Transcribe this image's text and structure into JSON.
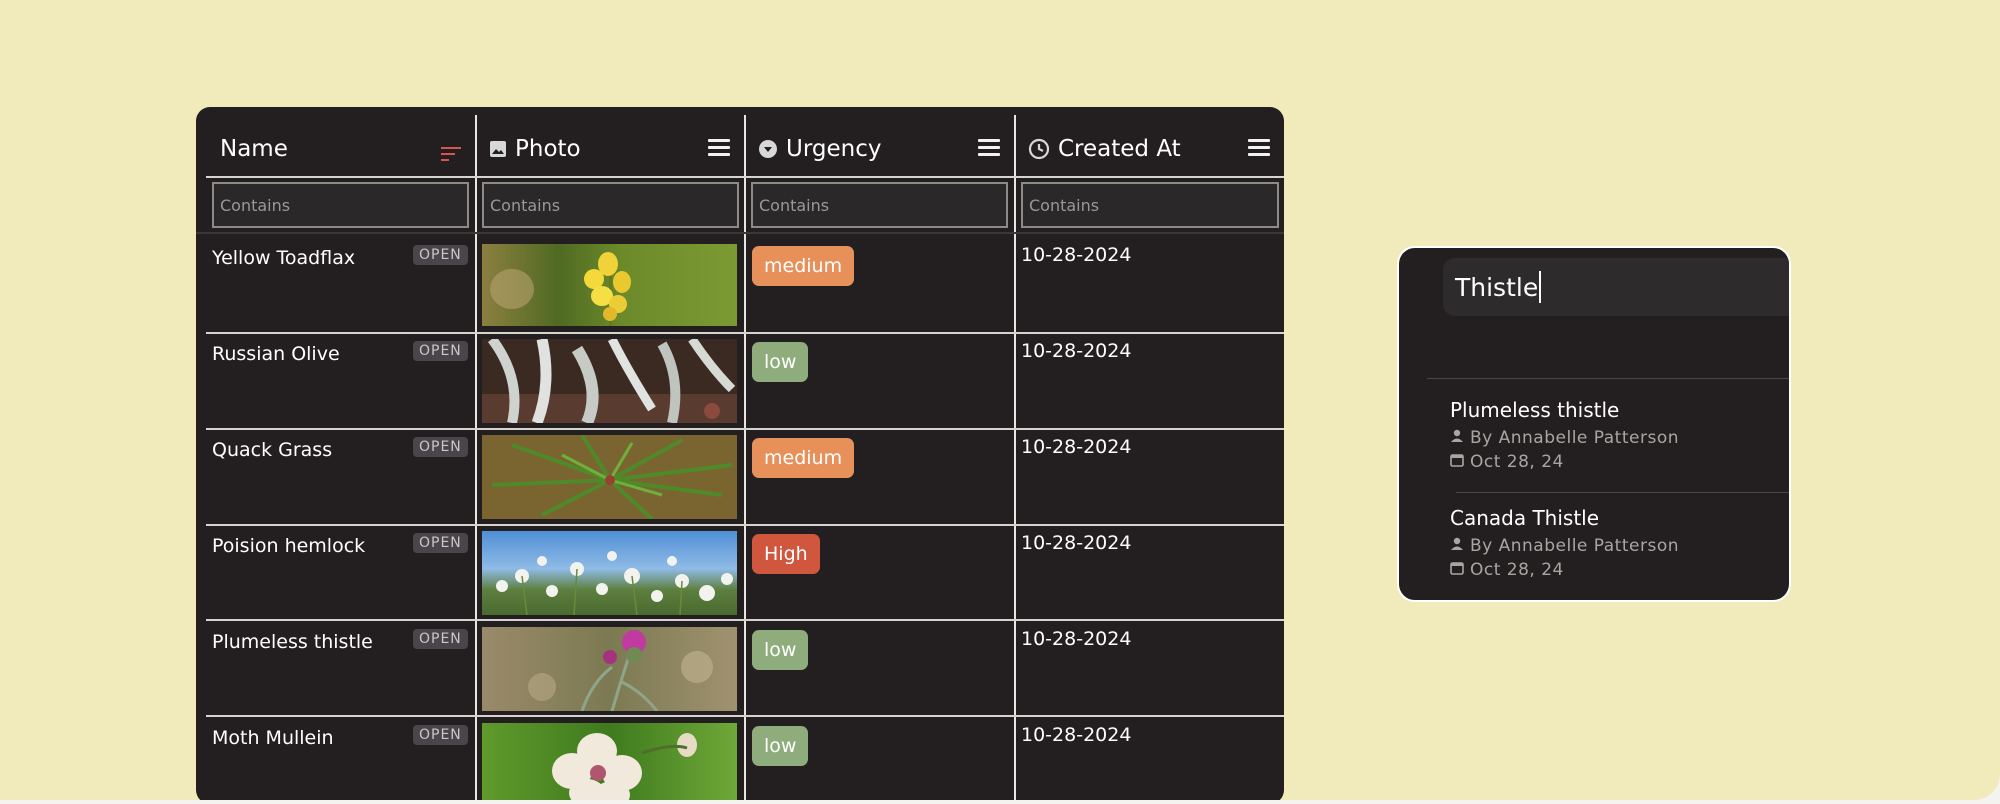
{
  "table": {
    "columns": [
      {
        "key": "name",
        "label": "Name",
        "icon": "sort-icon"
      },
      {
        "key": "photo",
        "label": "Photo",
        "icon": "image-icon"
      },
      {
        "key": "urgency",
        "label": "Urgency",
        "icon": "dropdown-circle-icon"
      },
      {
        "key": "created_at",
        "label": "Created At",
        "icon": "clock-icon"
      }
    ],
    "filter_placeholder": "Contains",
    "status_label": "OPEN",
    "rows": [
      {
        "name": "Yellow Toadflax",
        "urgency": "medium",
        "created_at": "10-28-2024"
      },
      {
        "name": "Russian Olive",
        "urgency": "low",
        "created_at": "10-28-2024"
      },
      {
        "name": "Quack Grass",
        "urgency": "medium",
        "created_at": "10-28-2024"
      },
      {
        "name": "Poision hemlock",
        "urgency": "High",
        "created_at": "10-28-2024"
      },
      {
        "name": "Plumeless thistle",
        "urgency": "low",
        "created_at": "10-28-2024"
      },
      {
        "name": "Moth Mullein",
        "urgency": "low",
        "created_at": "10-28-2024"
      }
    ]
  },
  "colors": {
    "background": "#f1ebbb",
    "panel": "#231f20",
    "urgency_medium": "#e8905a",
    "urgency_low": "#8fad7c",
    "urgency_high": "#d1563e",
    "sort_icon": "#d9534f"
  },
  "search": {
    "query": "Thistle",
    "results": [
      {
        "title": "Plumeless thistle",
        "author": "By Annabelle Patterson",
        "date": "Oct 28, 24"
      },
      {
        "title": "Canada Thistle",
        "author": "By Annabelle Patterson",
        "date": "Oct 28, 24"
      }
    ]
  }
}
